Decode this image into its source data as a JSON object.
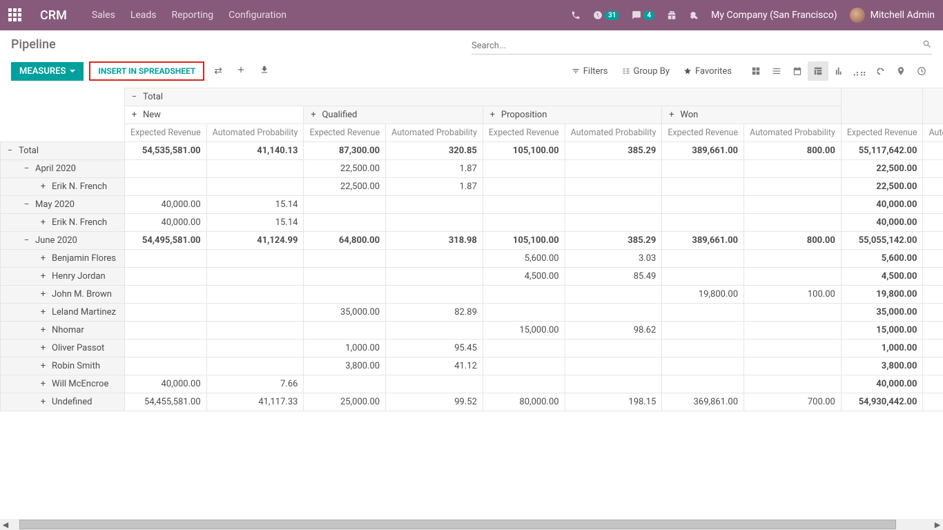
{
  "nav": {
    "brand": "CRM",
    "menu": [
      "Sales",
      "Leads",
      "Reporting",
      "Configuration"
    ],
    "badge31": "31",
    "badge4": "4",
    "company": "My Company (San Francisco)",
    "user": "Mitchell Admin"
  },
  "cp": {
    "title": "Pipeline",
    "search_placeholder": "Search...",
    "measures": "MEASURES",
    "insert": "INSERT IN SPREADSHEET",
    "filters": "Filters",
    "groupby": "Group By",
    "favorites": "Favorites"
  },
  "pivot": {
    "col_total": "Total",
    "cols": [
      "New",
      "Qualified",
      "Proposition",
      "Won"
    ],
    "measures": [
      "Expected Revenue",
      "Automated Probability"
    ],
    "total_col_hdr": "Expected Revenue",
    "total_col_hdr2": "Automated",
    "rows": [
      {
        "lvl": 0,
        "exp": "−",
        "label": "Total",
        "bold": true,
        "cells": [
          "54,535,581.00",
          "41,140.13",
          "87,300.00",
          "320.85",
          "105,100.00",
          "385.29",
          "389,661.00",
          "800.00",
          "55,117,642.00"
        ]
      },
      {
        "lvl": 1,
        "exp": "−",
        "label": "April 2020",
        "cells": [
          "",
          "",
          "22,500.00",
          "1.87",
          "",
          "",
          "",
          "",
          "22,500.00"
        ]
      },
      {
        "lvl": 2,
        "exp": "+",
        "label": "Erik N. French",
        "cells": [
          "",
          "",
          "22,500.00",
          "1.87",
          "",
          "",
          "",
          "",
          "22,500.00"
        ]
      },
      {
        "lvl": 1,
        "exp": "−",
        "label": "May 2020",
        "cells": [
          "40,000.00",
          "15.14",
          "",
          "",
          "",
          "",
          "",
          "",
          "40,000.00"
        ]
      },
      {
        "lvl": 2,
        "exp": "+",
        "label": "Erik N. French",
        "cells": [
          "40,000.00",
          "15.14",
          "",
          "",
          "",
          "",
          "",
          "",
          "40,000.00"
        ]
      },
      {
        "lvl": 1,
        "exp": "−",
        "label": "June 2020",
        "bold": true,
        "cells": [
          "54,495,581.00",
          "41,124.99",
          "64,800.00",
          "318.98",
          "105,100.00",
          "385.29",
          "389,661.00",
          "800.00",
          "55,055,142.00"
        ]
      },
      {
        "lvl": 2,
        "exp": "+",
        "label": "Benjamin Flores",
        "cells": [
          "",
          "",
          "",
          "",
          "5,600.00",
          "3.03",
          "",
          "",
          "5,600.00"
        ]
      },
      {
        "lvl": 2,
        "exp": "+",
        "label": "Henry Jordan",
        "cells": [
          "",
          "",
          "",
          "",
          "4,500.00",
          "85.49",
          "",
          "",
          "4,500.00"
        ]
      },
      {
        "lvl": 2,
        "exp": "+",
        "label": "John M. Brown",
        "cells": [
          "",
          "",
          "",
          "",
          "",
          "",
          "19,800.00",
          "100.00",
          "19,800.00"
        ]
      },
      {
        "lvl": 2,
        "exp": "+",
        "label": "Leland Martinez",
        "cells": [
          "",
          "",
          "35,000.00",
          "82.89",
          "",
          "",
          "",
          "",
          "35,000.00"
        ]
      },
      {
        "lvl": 2,
        "exp": "+",
        "label": "Nhomar",
        "cells": [
          "",
          "",
          "",
          "",
          "15,000.00",
          "98.62",
          "",
          "",
          "15,000.00"
        ]
      },
      {
        "lvl": 2,
        "exp": "+",
        "label": "Oliver Passot",
        "cells": [
          "",
          "",
          "1,000.00",
          "95.45",
          "",
          "",
          "",
          "",
          "1,000.00"
        ]
      },
      {
        "lvl": 2,
        "exp": "+",
        "label": "Robin Smith",
        "cells": [
          "",
          "",
          "3,800.00",
          "41.12",
          "",
          "",
          "",
          "",
          "3,800.00"
        ]
      },
      {
        "lvl": 2,
        "exp": "+",
        "label": "Will McEncroe",
        "cells": [
          "40,000.00",
          "7.66",
          "",
          "",
          "",
          "",
          "",
          "",
          "40,000.00"
        ]
      },
      {
        "lvl": 2,
        "exp": "+",
        "label": "Undefined",
        "cells": [
          "54,455,581.00",
          "41,117.33",
          "25,000.00",
          "99.52",
          "80,000.00",
          "198.15",
          "369,861.00",
          "700.00",
          "54,930,442.00"
        ]
      }
    ]
  }
}
